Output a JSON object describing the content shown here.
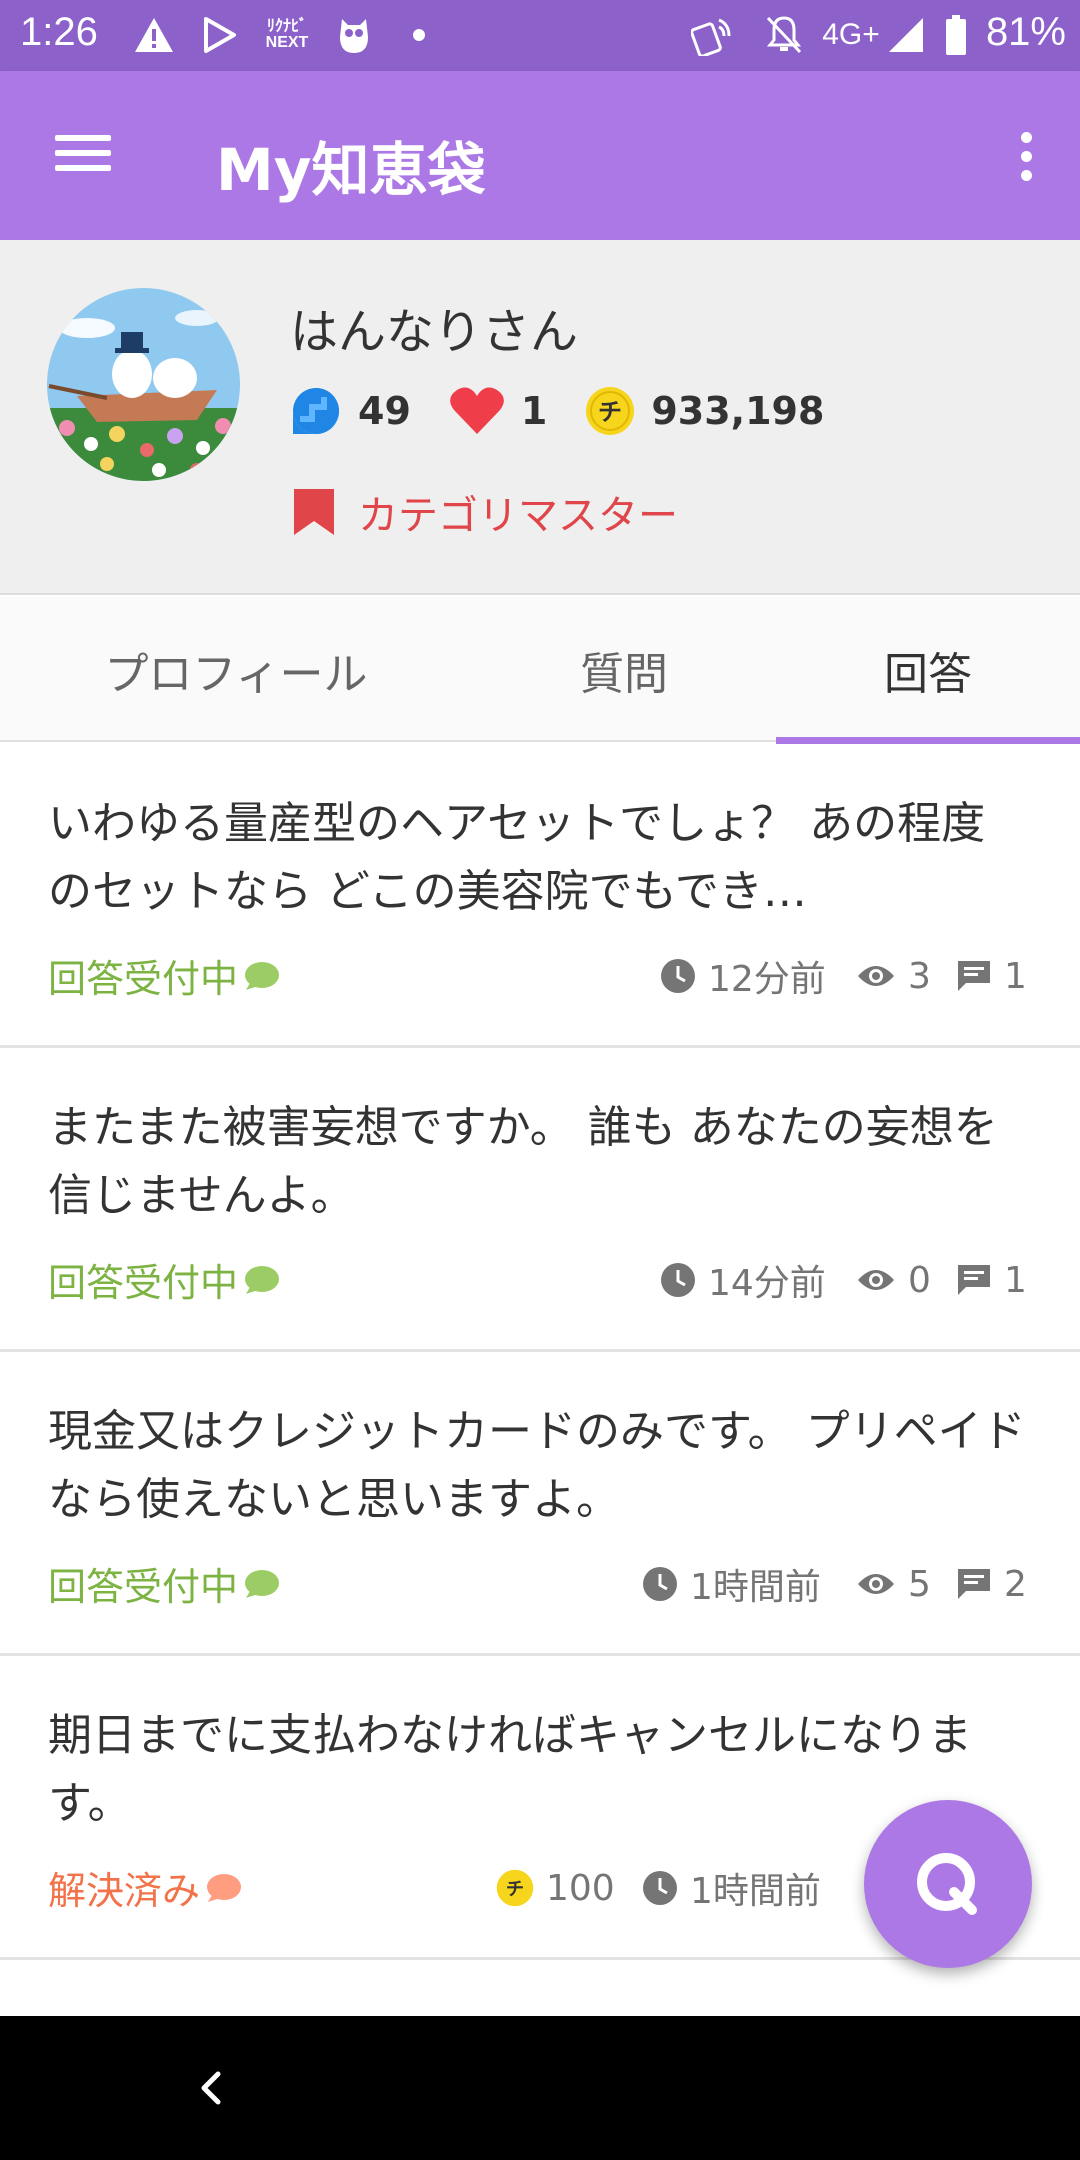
{
  "status_bar": {
    "time": "1:26",
    "battery_percent": "81%",
    "network": "4G+",
    "app_label_line1": "ﾘｸﾅﾋﾞ",
    "app_label_line2": "NEXT"
  },
  "app_bar": {
    "title": "My知恵袋",
    "accent_color": "#ab78e5"
  },
  "profile": {
    "username": "はんなりさん",
    "stats": {
      "answers": "49",
      "likes": "1",
      "coins": "933,198"
    },
    "coin_icon_char": "チ",
    "badge": "カテゴリマスター"
  },
  "tabs": [
    {
      "label": "プロフィール",
      "active": false
    },
    {
      "label": "質問",
      "active": false
    },
    {
      "label": "回答",
      "active": true
    }
  ],
  "answers": [
    {
      "text": "いわゆる量産型のヘアセットでしょ？ あの程度のセットなら どこの美容院でもでき…",
      "status": "回答受付中",
      "time": "12分前",
      "views": "3",
      "comments": "1"
    },
    {
      "text": "またまた被害妄想ですか。 誰も あなたの妄想を信じませんよ。",
      "status": "回答受付中",
      "time": "14分前",
      "views": "0",
      "comments": "1"
    },
    {
      "text": "現金又はクレジットカードのみです。 プリペイドなら使えないと思いますよ。",
      "status": "回答受付中",
      "time": "1時間前",
      "views": "5",
      "comments": "2"
    },
    {
      "text": "期日までに支払わなければキャンセルになります。",
      "status": "解決済み",
      "coin": "100",
      "time": "1時間前"
    }
  ],
  "colors": {
    "open_status": "#7cb342",
    "solved_status": "#f2724a",
    "badge": "#e0454a"
  }
}
